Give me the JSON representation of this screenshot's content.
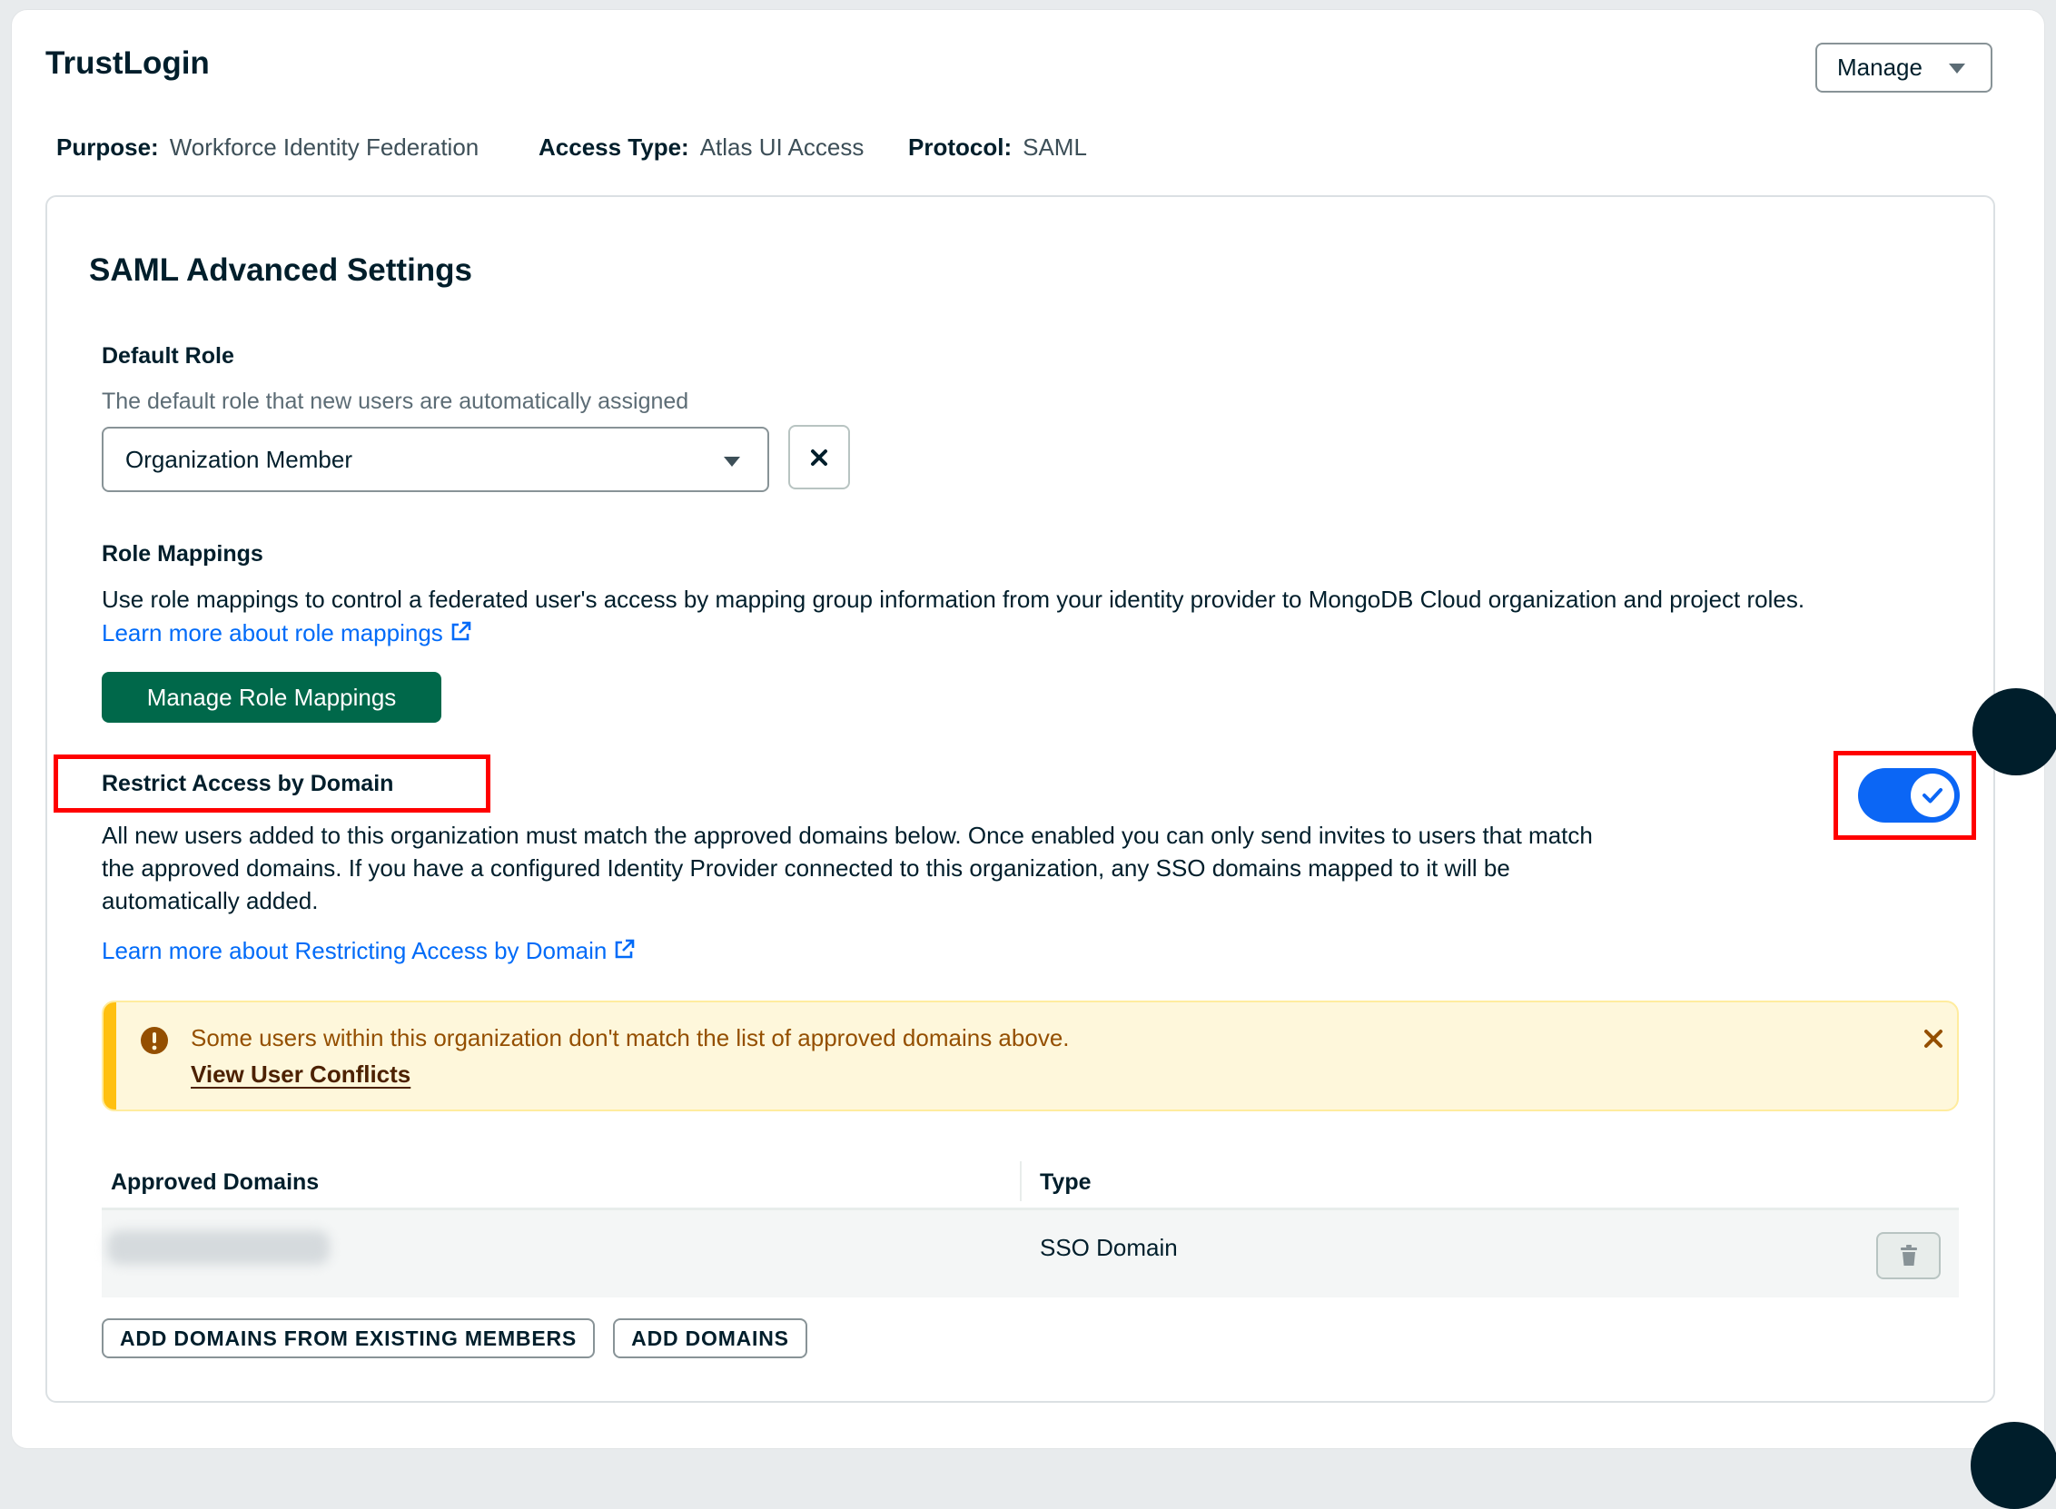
{
  "header": {
    "title": "TrustLogin",
    "manage_label": "Manage"
  },
  "meta": {
    "purpose_label": "Purpose:",
    "purpose_value": "Workforce Identity Federation",
    "access_type_label": "Access Type:",
    "access_type_value": "Atlas UI Access",
    "protocol_label": "Protocol:",
    "protocol_value": "SAML"
  },
  "settings": {
    "title": "SAML Advanced Settings",
    "default_role": {
      "label": "Default Role",
      "description": "The default role that new users are automatically assigned",
      "selected_value": "Organization Member",
      "clear_icon": "close-icon"
    },
    "role_mappings": {
      "label": "Role Mappings",
      "description": "Use role mappings to control a federated user's access by mapping group information from your identity provider to MongoDB Cloud organization and project roles.",
      "link_text": "Learn more about role mappings",
      "button_label": "Manage Role Mappings"
    },
    "restrict_access": {
      "label": "Restrict Access by Domain",
      "toggle_enabled": true,
      "description_line1": "All new users added to this organization must match the approved domains below. Once enabled you can only send invites to users that match",
      "description_line2": "the approved domains. If you have a configured Identity Provider connected to this organization, any SSO domains mapped to it will be",
      "description_line3": "automatically added.",
      "link_text": "Learn more about Restricting Access by Domain"
    },
    "banner": {
      "icon": "warning-circle-icon",
      "message": "Some users within this organization don't match the list of approved domains above.",
      "link_text": "View User Conflicts",
      "close_icon": "close-icon"
    },
    "table": {
      "columns": [
        "Approved Domains",
        "Type"
      ],
      "rows": [
        {
          "domain": "",
          "type": "SSO Domain"
        }
      ]
    },
    "buttons": {
      "add_from_members": "ADD DOMAINS FROM EXISTING MEMBERS",
      "add_domains": "ADD DOMAINS"
    }
  },
  "colors": {
    "primary_text": "#001e2b",
    "link": "#016bf8",
    "green_button": "#00684a",
    "toggle_on": "#0b66f5",
    "highlight": "#ff0000",
    "banner_bg": "#fef7db",
    "banner_stripe": "#ffc010"
  }
}
